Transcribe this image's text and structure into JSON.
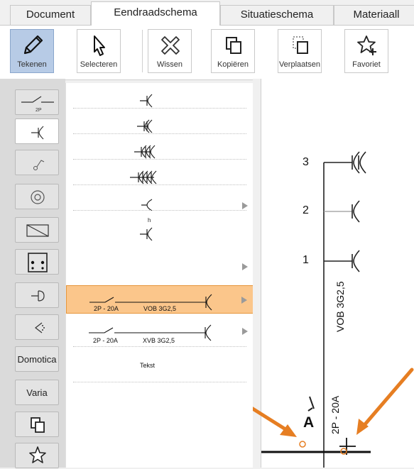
{
  "tabs": [
    {
      "label": "Document",
      "active": false
    },
    {
      "label": "Eendraadschema",
      "active": true
    },
    {
      "label": "Situatieschema",
      "active": false
    },
    {
      "label": "Materiaall",
      "active": false
    }
  ],
  "toolbar": {
    "buttons": [
      {
        "label": "Tekenen",
        "icon": "pencil-icon",
        "active": true
      },
      {
        "label": "Selecteren",
        "icon": "cursor-icon",
        "active": false
      },
      {
        "label": "Wissen",
        "icon": "erase-x-icon",
        "active": false
      },
      {
        "label": "Kopiëren",
        "icon": "copy-icon",
        "active": false
      },
      {
        "label": "Verplaatsen",
        "icon": "move-icon",
        "active": false
      },
      {
        "label": "Favoriet",
        "icon": "star-add-icon",
        "active": false
      }
    ]
  },
  "sidebar": {
    "items": [
      {
        "name": "switch-2p",
        "label": "2P"
      },
      {
        "name": "socket",
        "label": ""
      },
      {
        "name": "switch-light",
        "label": ""
      },
      {
        "name": "lamp",
        "label": ""
      },
      {
        "name": "heater",
        "label": ""
      },
      {
        "name": "dice",
        "label": ""
      },
      {
        "name": "bell",
        "label": ""
      },
      {
        "name": "speaker",
        "label": ""
      },
      {
        "name": "domotica",
        "label": "Domotica"
      },
      {
        "name": "varia",
        "label": "Varia"
      },
      {
        "name": "copy",
        "label": ""
      },
      {
        "name": "favorite",
        "label": ""
      }
    ]
  },
  "panel": {
    "rows": [
      {
        "type": "socket-1"
      },
      {
        "type": "socket-2"
      },
      {
        "type": "socket-3"
      },
      {
        "type": "socket-4"
      },
      {
        "type": "socket-plain",
        "has_arrow": true
      },
      {
        "type": "socket-h",
        "label": "h",
        "has_arrow": true
      },
      {
        "type": "circuit",
        "selected": true,
        "left_label": "2P - 20A",
        "right_label": "VOB 3G2,5",
        "has_arrow": true
      },
      {
        "type": "circuit",
        "selected": false,
        "left_label": "2P - 20A",
        "right_label": "XVB 3G2,5",
        "has_arrow": true
      },
      {
        "type": "text",
        "label": "Tekst"
      }
    ]
  },
  "canvas": {
    "circuit_numbers": [
      "3",
      "2",
      "1"
    ],
    "cable_label": "VOB 3G2,5",
    "breaker_label": "2P - 20A",
    "breaker_letter": "A",
    "annotation_color": "#e67e22"
  }
}
